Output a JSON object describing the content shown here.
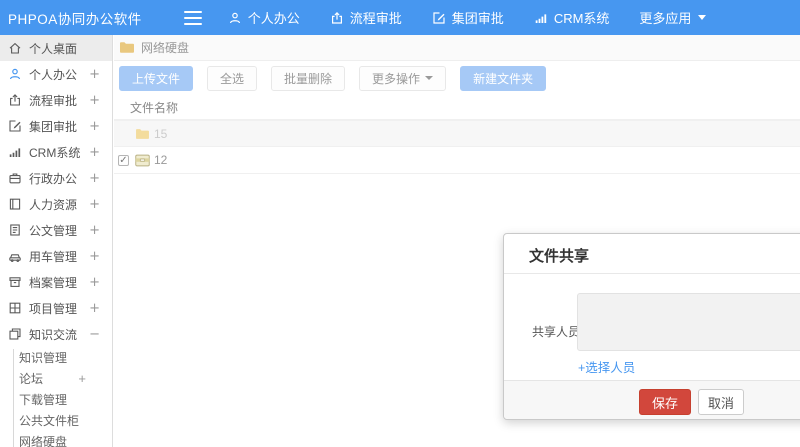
{
  "colors": {
    "accent": "#4797f0",
    "primary_light": "#a6c9f6",
    "danger": "#d2473c",
    "active_item_bg": "#ececec"
  },
  "topbar": {
    "logo": "PHPOA协同办公软件",
    "items": [
      {
        "label": "个人办公"
      },
      {
        "label": "流程审批"
      },
      {
        "label": "集团审批"
      },
      {
        "label": "CRM系统"
      },
      {
        "label": "更多应用"
      }
    ]
  },
  "sidebar": {
    "items": [
      {
        "label": "个人桌面",
        "expand": ""
      },
      {
        "label": "个人办公",
        "expand": "+"
      },
      {
        "label": "流程审批",
        "expand": "+"
      },
      {
        "label": "集团审批",
        "expand": "+"
      },
      {
        "label": "CRM系统",
        "expand": "+"
      },
      {
        "label": "行政办公",
        "expand": "+"
      },
      {
        "label": "人力资源",
        "expand": "+"
      },
      {
        "label": "公文管理",
        "expand": "+"
      },
      {
        "label": "用车管理",
        "expand": "+"
      },
      {
        "label": "档案管理",
        "expand": "+"
      },
      {
        "label": "项目管理",
        "expand": "+"
      },
      {
        "label": "知识交流",
        "expand": "−"
      }
    ],
    "subitems": [
      {
        "label": "知识管理",
        "expand": ""
      },
      {
        "label": "论坛",
        "expand": "+"
      },
      {
        "label": "下载管理",
        "expand": ""
      },
      {
        "label": "公共文件柜",
        "expand": ""
      },
      {
        "label": "网络硬盘",
        "expand": ""
      }
    ]
  },
  "breadcrumb": {
    "label": "网络硬盘"
  },
  "toolbar": {
    "upload": "上传文件",
    "select_all": "全选",
    "batch_delete": "批量删除",
    "more_ops": "更多操作",
    "new_folder": "新建文件夹"
  },
  "file_table": {
    "header": "文件名称",
    "rows": [
      {
        "name": "15",
        "type": "folder",
        "checked": false,
        "check_glyph": ""
      },
      {
        "name": "12",
        "type": "archive",
        "checked": true,
        "check_glyph": "✓"
      }
    ]
  },
  "modal": {
    "title": "文件共享",
    "label": "共享人员",
    "field_value": "",
    "link": "+选择人员",
    "save": "保存",
    "cancel": "取消"
  }
}
